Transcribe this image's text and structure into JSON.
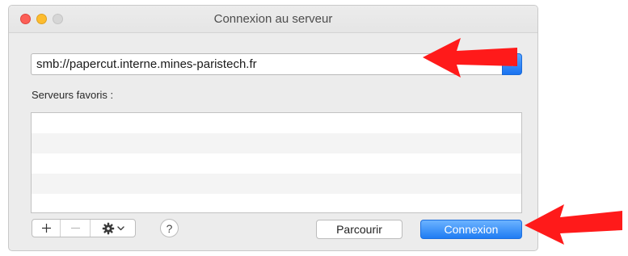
{
  "window": {
    "title": "Connexion au serveur"
  },
  "server": {
    "address_value": "smb://papercut.interne.mines-paristech.fr"
  },
  "favorites": {
    "label": "Serveurs favoris :",
    "items": []
  },
  "controls": {
    "add_icon": "plus-icon",
    "remove_icon": "minus-icon",
    "gear_icon": "gear-icon",
    "help_label": "?",
    "browse_label": "Parcourir",
    "connect_label": "Connexion"
  },
  "colors": {
    "accent": "#1f7cf3",
    "annotation_arrow": "#ff0000"
  }
}
